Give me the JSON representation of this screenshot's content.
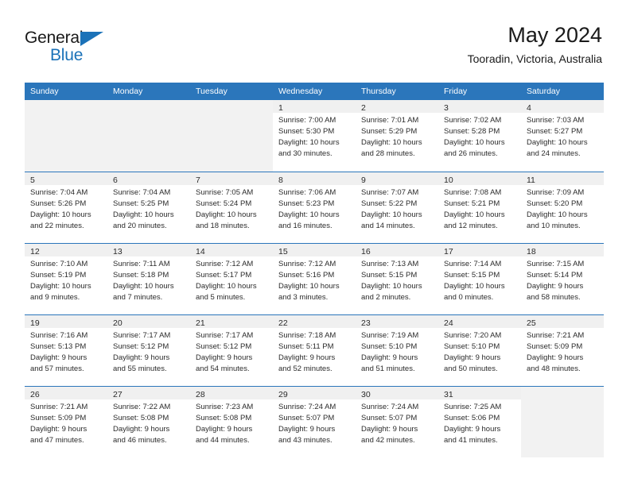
{
  "brand": {
    "word_one": "General",
    "word_two": "Blue",
    "triangle_color": "#1b72b8",
    "blue_text_color": "#1b72b8"
  },
  "header": {
    "title": "May 2024",
    "subtitle": "Tooradin, Victoria, Australia"
  },
  "calendar": {
    "header_bg": "#2b76bb",
    "header_text_color": "#ffffff",
    "weekdays": [
      "Sunday",
      "Monday",
      "Tuesday",
      "Wednesday",
      "Thursday",
      "Friday",
      "Saturday"
    ],
    "weeks": [
      [
        {
          "day": "",
          "lines": []
        },
        {
          "day": "",
          "lines": []
        },
        {
          "day": "",
          "lines": []
        },
        {
          "day": "1",
          "lines": [
            "Sunrise: 7:00 AM",
            "Sunset: 5:30 PM",
            "Daylight: 10 hours",
            "and 30 minutes."
          ]
        },
        {
          "day": "2",
          "lines": [
            "Sunrise: 7:01 AM",
            "Sunset: 5:29 PM",
            "Daylight: 10 hours",
            "and 28 minutes."
          ]
        },
        {
          "day": "3",
          "lines": [
            "Sunrise: 7:02 AM",
            "Sunset: 5:28 PM",
            "Daylight: 10 hours",
            "and 26 minutes."
          ]
        },
        {
          "day": "4",
          "lines": [
            "Sunrise: 7:03 AM",
            "Sunset: 5:27 PM",
            "Daylight: 10 hours",
            "and 24 minutes."
          ]
        }
      ],
      [
        {
          "day": "5",
          "lines": [
            "Sunrise: 7:04 AM",
            "Sunset: 5:26 PM",
            "Daylight: 10 hours",
            "and 22 minutes."
          ]
        },
        {
          "day": "6",
          "lines": [
            "Sunrise: 7:04 AM",
            "Sunset: 5:25 PM",
            "Daylight: 10 hours",
            "and 20 minutes."
          ]
        },
        {
          "day": "7",
          "lines": [
            "Sunrise: 7:05 AM",
            "Sunset: 5:24 PM",
            "Daylight: 10 hours",
            "and 18 minutes."
          ]
        },
        {
          "day": "8",
          "lines": [
            "Sunrise: 7:06 AM",
            "Sunset: 5:23 PM",
            "Daylight: 10 hours",
            "and 16 minutes."
          ]
        },
        {
          "day": "9",
          "lines": [
            "Sunrise: 7:07 AM",
            "Sunset: 5:22 PM",
            "Daylight: 10 hours",
            "and 14 minutes."
          ]
        },
        {
          "day": "10",
          "lines": [
            "Sunrise: 7:08 AM",
            "Sunset: 5:21 PM",
            "Daylight: 10 hours",
            "and 12 minutes."
          ]
        },
        {
          "day": "11",
          "lines": [
            "Sunrise: 7:09 AM",
            "Sunset: 5:20 PM",
            "Daylight: 10 hours",
            "and 10 minutes."
          ]
        }
      ],
      [
        {
          "day": "12",
          "lines": [
            "Sunrise: 7:10 AM",
            "Sunset: 5:19 PM",
            "Daylight: 10 hours",
            "and 9 minutes."
          ]
        },
        {
          "day": "13",
          "lines": [
            "Sunrise: 7:11 AM",
            "Sunset: 5:18 PM",
            "Daylight: 10 hours",
            "and 7 minutes."
          ]
        },
        {
          "day": "14",
          "lines": [
            "Sunrise: 7:12 AM",
            "Sunset: 5:17 PM",
            "Daylight: 10 hours",
            "and 5 minutes."
          ]
        },
        {
          "day": "15",
          "lines": [
            "Sunrise: 7:12 AM",
            "Sunset: 5:16 PM",
            "Daylight: 10 hours",
            "and 3 minutes."
          ]
        },
        {
          "day": "16",
          "lines": [
            "Sunrise: 7:13 AM",
            "Sunset: 5:15 PM",
            "Daylight: 10 hours",
            "and 2 minutes."
          ]
        },
        {
          "day": "17",
          "lines": [
            "Sunrise: 7:14 AM",
            "Sunset: 5:15 PM",
            "Daylight: 10 hours",
            "and 0 minutes."
          ]
        },
        {
          "day": "18",
          "lines": [
            "Sunrise: 7:15 AM",
            "Sunset: 5:14 PM",
            "Daylight: 9 hours",
            "and 58 minutes."
          ]
        }
      ],
      [
        {
          "day": "19",
          "lines": [
            "Sunrise: 7:16 AM",
            "Sunset: 5:13 PM",
            "Daylight: 9 hours",
            "and 57 minutes."
          ]
        },
        {
          "day": "20",
          "lines": [
            "Sunrise: 7:17 AM",
            "Sunset: 5:12 PM",
            "Daylight: 9 hours",
            "and 55 minutes."
          ]
        },
        {
          "day": "21",
          "lines": [
            "Sunrise: 7:17 AM",
            "Sunset: 5:12 PM",
            "Daylight: 9 hours",
            "and 54 minutes."
          ]
        },
        {
          "day": "22",
          "lines": [
            "Sunrise: 7:18 AM",
            "Sunset: 5:11 PM",
            "Daylight: 9 hours",
            "and 52 minutes."
          ]
        },
        {
          "day": "23",
          "lines": [
            "Sunrise: 7:19 AM",
            "Sunset: 5:10 PM",
            "Daylight: 9 hours",
            "and 51 minutes."
          ]
        },
        {
          "day": "24",
          "lines": [
            "Sunrise: 7:20 AM",
            "Sunset: 5:10 PM",
            "Daylight: 9 hours",
            "and 50 minutes."
          ]
        },
        {
          "day": "25",
          "lines": [
            "Sunrise: 7:21 AM",
            "Sunset: 5:09 PM",
            "Daylight: 9 hours",
            "and 48 minutes."
          ]
        }
      ],
      [
        {
          "day": "26",
          "lines": [
            "Sunrise: 7:21 AM",
            "Sunset: 5:09 PM",
            "Daylight: 9 hours",
            "and 47 minutes."
          ]
        },
        {
          "day": "27",
          "lines": [
            "Sunrise: 7:22 AM",
            "Sunset: 5:08 PM",
            "Daylight: 9 hours",
            "and 46 minutes."
          ]
        },
        {
          "day": "28",
          "lines": [
            "Sunrise: 7:23 AM",
            "Sunset: 5:08 PM",
            "Daylight: 9 hours",
            "and 44 minutes."
          ]
        },
        {
          "day": "29",
          "lines": [
            "Sunrise: 7:24 AM",
            "Sunset: 5:07 PM",
            "Daylight: 9 hours",
            "and 43 minutes."
          ]
        },
        {
          "day": "30",
          "lines": [
            "Sunrise: 7:24 AM",
            "Sunset: 5:07 PM",
            "Daylight: 9 hours",
            "and 42 minutes."
          ]
        },
        {
          "day": "31",
          "lines": [
            "Sunrise: 7:25 AM",
            "Sunset: 5:06 PM",
            "Daylight: 9 hours",
            "and 41 minutes."
          ]
        },
        {
          "day": "",
          "lines": []
        }
      ]
    ]
  }
}
